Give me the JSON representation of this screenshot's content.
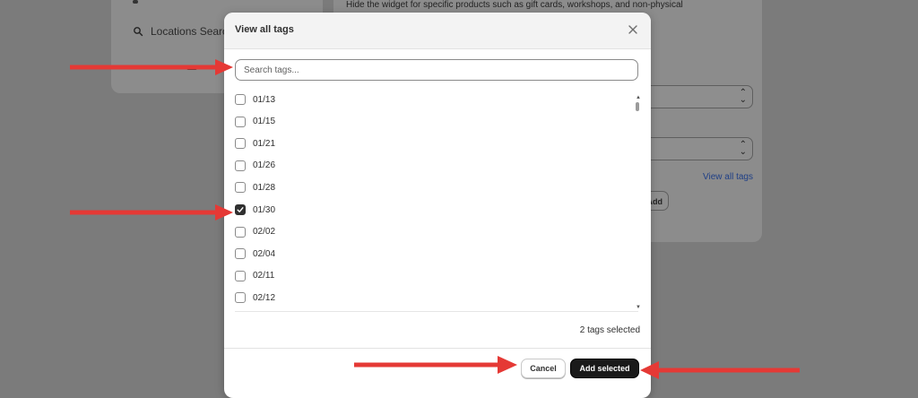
{
  "background": {
    "sidebar": {
      "item_label": "Locations Search"
    },
    "main": {
      "help_text": "Hide the widget for specific products such as gift cards, workshops, and non-physical",
      "view_all_link": "View all tags",
      "add_button_label": "Add"
    }
  },
  "modal": {
    "title": "View all tags",
    "search": {
      "placeholder": "Search tags...",
      "value": ""
    },
    "tags": [
      {
        "label": "01/13",
        "checked": false
      },
      {
        "label": "01/15",
        "checked": false
      },
      {
        "label": "01/21",
        "checked": false
      },
      {
        "label": "01/26",
        "checked": false
      },
      {
        "label": "01/28",
        "checked": false
      },
      {
        "label": "01/30",
        "checked": true
      },
      {
        "label": "02/02",
        "checked": false
      },
      {
        "label": "02/04",
        "checked": false
      },
      {
        "label": "02/11",
        "checked": false
      },
      {
        "label": "02/12",
        "checked": false
      }
    ],
    "selected_count": "2 tags selected",
    "cancel_label": "Cancel",
    "add_selected_label": "Add selected"
  },
  "colors": {
    "annotation_arrow": "#e53935",
    "primary_button": "#1a1a1a",
    "link": "#1f3f86"
  },
  "icons": [
    "search-icon",
    "close-icon",
    "checkmark-icon",
    "chevron-up-down-icon"
  ]
}
